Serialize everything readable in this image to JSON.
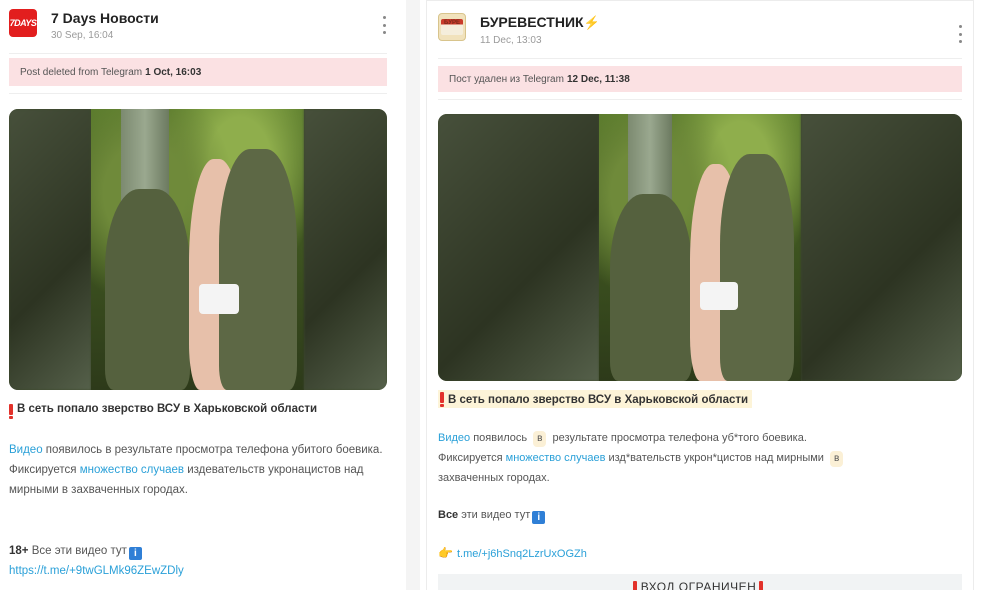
{
  "left_post": {
    "channel_logo_text": "7DAYS",
    "channel_name": "7 Days Новости",
    "date": "30 Sep, 16:04",
    "banner_text": "Post deleted from Telegram",
    "banner_date": "1 Oct, 16:03",
    "headline": "В сеть попало зверство ВСУ в Харьковской области",
    "body_link_1": "Видео",
    "body_text_1": " появилось в результате просмотра телефона убитого боевика.",
    "body_text_2": "Фиксируется ",
    "body_link_2": "множество случаев",
    "body_text_3": " издевательств укронацистов над мирными в захваченных городах.",
    "age_label": "18+",
    "videos_text": " Все эти видео тут",
    "info_icon": "i",
    "url": "https://t.me/+9twGLMk96ZEwZDly"
  },
  "right_post": {
    "channel_logo_text": "БУРЕ",
    "channel_name": "БУРЕВЕСТНИК",
    "channel_emoji": "⚡",
    "date": "11 Dec, 13:03",
    "banner_text": "Пост удален из Telegram",
    "banner_date": "12 Dec, 11:38",
    "headline": "В сеть попало зверство ВСУ в Харьковской области",
    "body_link_1": "Видео",
    "body_text_1a": " появилось ",
    "chip_1": "в",
    "body_text_1b": " результате просмотра телефона уб*того боевика.",
    "body_text_2": "Фиксируется ",
    "body_link_2": "множество случаев",
    "body_text_3": " изд*вательств укрон*цистов над мирными ",
    "chip_2": "в",
    "body_text_4": "захваченных городах.",
    "videos_bold": "Все",
    "videos_text": " эти видео тут",
    "info_icon": "i",
    "hand_icon": "👉",
    "url": "t.me/+j6hSnq2LzrUxOGZh",
    "cta_text": "ВХОД ОГРАНИЧЕН"
  },
  "colors": {
    "banner_bg": "#fbe1e3",
    "link": "#2aa0d8",
    "logo_red": "#e21e1e",
    "info_blue": "#2f7fd6"
  }
}
